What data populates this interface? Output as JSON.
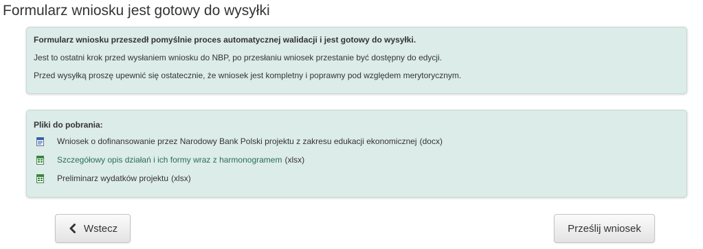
{
  "page": {
    "title": "Formularz wniosku jest gotowy do wysyłki"
  },
  "info_panel": {
    "headline": "Formularz wniosku przeszedł pomyślnie proces automatycznej walidacji i jest gotowy do wysyłki.",
    "line_1": "Jest to ostatni krok przed wysłaniem wniosku do NBP, po przesłaniu wniosek przestanie być dostępny do edycji.",
    "line_2": "Przed wysyłką proszę upewnić się ostatecznie, że wniosek jest kompletny i poprawny pod względem merytorycznym."
  },
  "files_panel": {
    "heading": "Pliki do pobrania:",
    "files": [
      {
        "icon": "word-document-icon",
        "label": "Wniosek o dofinansowanie przez Narodowy Bank Polski projektu z zakresu edukacji ekonomicznej",
        "ext": "(docx)"
      },
      {
        "icon": "excel-spreadsheet-icon",
        "label": "Szczegółowy opis działań i ich formy wraz z harmonogramem",
        "ext": "(xlsx)"
      },
      {
        "icon": "excel-spreadsheet-icon",
        "label": "Preliminarz wydatków projektu",
        "ext": "(xlsx)"
      }
    ]
  },
  "buttons": {
    "back_label": "Wstecz",
    "back_icon": "chevron-left-icon",
    "submit_label": "Prześlij wniosek"
  },
  "colors": {
    "panel_background": "#dcece8",
    "panel_border": "#c6d9d4",
    "link": "#2b6d5a"
  }
}
